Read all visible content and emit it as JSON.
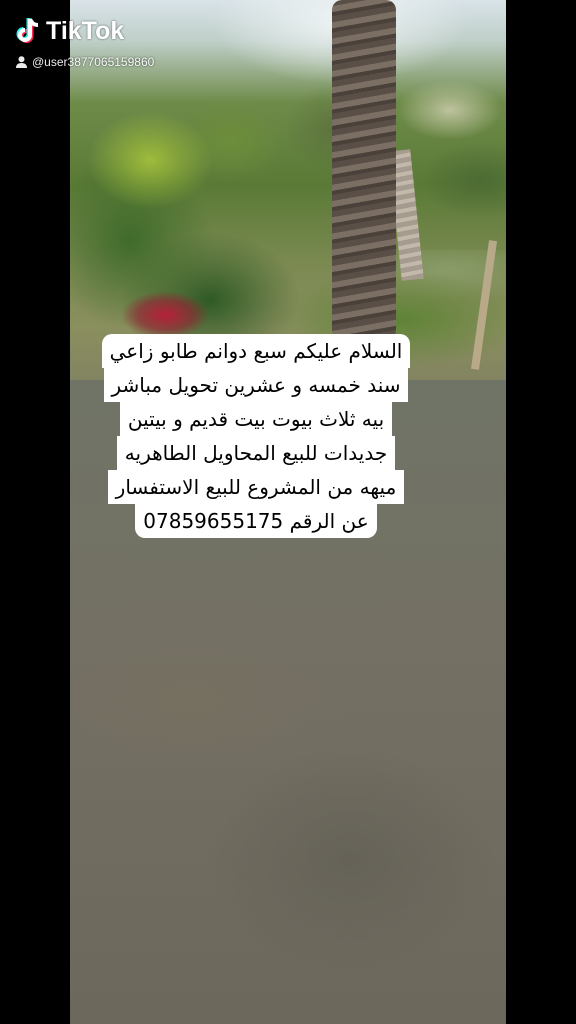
{
  "watermark": {
    "brand": "TikTok",
    "username": "@user3877065159860",
    "logo_icon": "tiktok-note-icon",
    "user_icon": "person-icon"
  },
  "caption": {
    "lines": [
      "السلام عليكم سبع دوانم طابو زاعي",
      "سند خمسه و عشرين تحويل مباشر",
      "بيه ثلاث بيوت بيت قديم و بيتين",
      "جديدات للبيع المحاويل الطاهريه",
      "ميهه من المشروع للبيع الاستفسار",
      "عن الرقم 07859655175"
    ]
  },
  "colors": {
    "tiktok_cyan": "#25F4EE",
    "tiktok_red": "#FE2C55",
    "caption_bg": "#FFFFFF"
  }
}
